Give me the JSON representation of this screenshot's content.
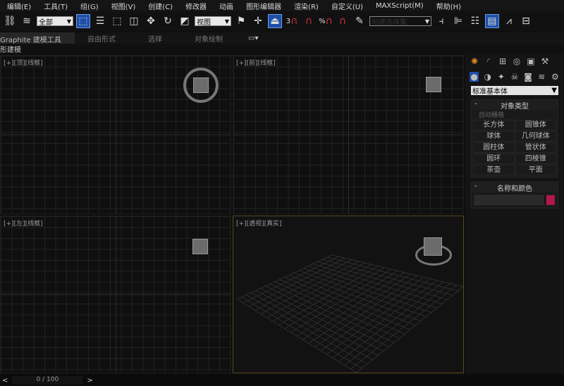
{
  "menu": [
    "编辑(E)",
    "工具(T)",
    "组(G)",
    "视图(V)",
    "创建(C)",
    "修改器",
    "动画",
    "图形编辑器",
    "渲染(R)",
    "自定义(U)",
    "MAXScript(M)",
    "帮助(H)"
  ],
  "toolbar": {
    "selection_filter": "全部",
    "ref_coord": "视图",
    "named_selection": "创建选择集",
    "snap_angle_label": "3",
    "percent_label": "%"
  },
  "ribbon": {
    "tabs": [
      "Graphite 建模工具",
      "自由形式",
      "选择",
      "对象绘制"
    ],
    "sub_label": "形建模"
  },
  "viewports": [
    {
      "label": "[+][顶][线框]"
    },
    {
      "label": "[+][前][线框]"
    },
    {
      "label": "[+][左][线框]"
    },
    {
      "label": "[+][透视][真实]"
    }
  ],
  "panel": {
    "category": "标准基本体",
    "object_type_title": "对象类型",
    "autogrid": "自动栅格",
    "objects": [
      "长方体",
      "圆锥体",
      "球体",
      "几何球体",
      "圆柱体",
      "管状体",
      "圆环",
      "四棱锥",
      "茶壶",
      "平面"
    ],
    "name_color_title": "名称和颜色",
    "object_color": "#b01848"
  },
  "timeline": {
    "prev": "<",
    "frame": "0 / 100",
    "next": ">"
  },
  "colors": {
    "accent": "#1f4fa8",
    "active_viewport_border": "#5a4a20"
  }
}
